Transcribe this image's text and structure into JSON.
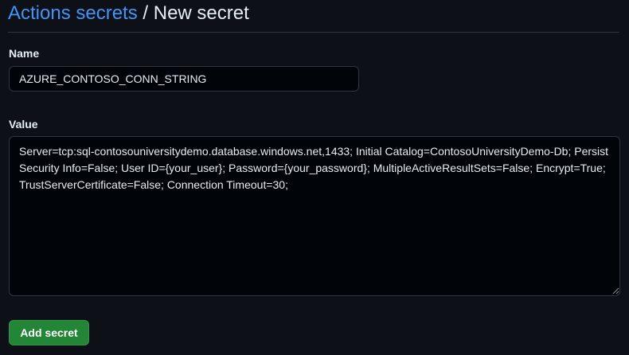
{
  "breadcrumb": {
    "parent_label": "Actions secrets",
    "separator": "/",
    "current_label": "New secret"
  },
  "form": {
    "name_label": "Name",
    "name_value": "AZURE_CONTOSO_CONN_STRING",
    "value_label": "Value",
    "value_text": "Server=tcp:sql-contosouniversitydemo.database.windows.net,1433; Initial Catalog=ContosoUniversityDemo-Db; Persist Security Info=False; User ID={your_user}; Password={your_password}; MultipleActiveResultSets=False; Encrypt=True; TrustServerCertificate=False; Connection Timeout=30;",
    "submit_label": "Add secret"
  },
  "colors": {
    "background": "#0d1117",
    "link": "#4493f8",
    "primary_button": "#238636",
    "input_background": "#010409",
    "border": "#30363d"
  },
  "icons": {
    "resize_grip": "resize-grip-icon"
  }
}
